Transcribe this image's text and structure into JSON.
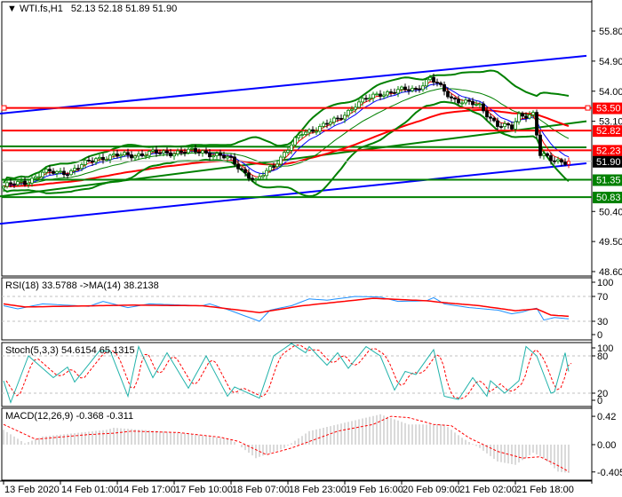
{
  "header": {
    "symbol": "WTI.fs,H1",
    "ohlc": "52.13 52.18 51.89 51.90"
  },
  "chart_data": {
    "type": "candlestick",
    "title": "WTI.fs,H1",
    "bars": 160,
    "price_range": [
      48.45,
      56.05
    ],
    "price_ticks": [
      "55.80",
      "54.90",
      "54.00",
      "53.10",
      "50.40",
      "49.50",
      "48.60"
    ],
    "time_labels": [
      {
        "bar": 0,
        "label": "13 Feb 2020"
      },
      {
        "bar": 16,
        "label": "14 Feb 01:00"
      },
      {
        "bar": 32,
        "label": "14 Feb 17:00"
      },
      {
        "bar": 48,
        "label": "17 Feb 10:00"
      },
      {
        "bar": 64,
        "label": "18 Feb 07:00"
      },
      {
        "bar": 80,
        "label": "18 Feb 23:00"
      },
      {
        "bar": 96,
        "label": "19 Feb 16:00"
      },
      {
        "bar": 112,
        "label": "20 Feb 09:00"
      },
      {
        "bar": 128,
        "label": "21 Feb 02:00"
      },
      {
        "bar": 144,
        "label": "21 Feb 18:00"
      }
    ],
    "close_keypoints": [
      [
        0,
        51.15
      ],
      [
        6,
        51.28
      ],
      [
        11,
        51.55
      ],
      [
        19,
        51.6
      ],
      [
        26,
        52.0
      ],
      [
        34,
        52.08
      ],
      [
        44,
        52.16
      ],
      [
        56,
        52.2
      ],
      [
        64,
        51.95
      ],
      [
        71,
        51.28
      ],
      [
        76,
        51.8
      ],
      [
        84,
        52.74
      ],
      [
        94,
        53.14
      ],
      [
        99,
        53.6
      ],
      [
        106,
        53.94
      ],
      [
        116,
        54.07
      ],
      [
        120,
        54.39
      ],
      [
        126,
        53.8
      ],
      [
        134,
        53.54
      ],
      [
        139,
        53.0
      ],
      [
        143,
        52.88
      ],
      [
        145,
        53.28
      ],
      [
        149,
        53.33
      ],
      [
        151,
        52.08
      ],
      [
        154,
        51.95
      ],
      [
        159,
        51.9
      ]
    ],
    "levels": [
      {
        "price": 53.5,
        "label": "53.50",
        "color": "#ff0000"
      },
      {
        "price": 52.82,
        "label": "52.82",
        "color": "#ff0000"
      },
      {
        "price": 52.23,
        "label": "52.23",
        "color": "#ff0000"
      },
      {
        "price": 51.9,
        "label": "51.90",
        "color": "#000000"
      },
      {
        "price": 51.35,
        "label": "51.35",
        "color": "#008000"
      },
      {
        "price": 50.83,
        "label": "50.83",
        "color": "#008000"
      }
    ],
    "channel": {
      "upper": [
        [
          -1,
          53.33
        ],
        [
          164,
          55.06
        ]
      ],
      "lower": [
        [
          -1,
          50.03
        ],
        [
          164,
          51.84
        ]
      ],
      "color": "#0000ff"
    },
    "green_trend": [
      [
        -1,
        50.85
      ],
      [
        164,
        53.1
      ]
    ],
    "green_flat": [
      [
        -1,
        52.35
      ],
      [
        164,
        52.32
      ]
    ],
    "rsi": {
      "label": "RSI(18) 33.5788  ->MA(14) 38.2138",
      "ticks": [
        "100",
        "70",
        "30",
        "0"
      ],
      "levels": [
        70,
        30
      ],
      "values": [
        [
          0,
          55
        ],
        [
          4,
          50
        ],
        [
          11,
          58
        ],
        [
          24,
          54
        ],
        [
          28,
          62
        ],
        [
          35,
          52
        ],
        [
          41,
          58
        ],
        [
          56,
          55
        ],
        [
          58,
          58
        ],
        [
          64,
          47
        ],
        [
          72,
          30
        ],
        [
          75,
          48
        ],
        [
          81,
          55
        ],
        [
          86,
          66
        ],
        [
          91,
          64
        ],
        [
          99,
          70
        ],
        [
          106,
          69
        ],
        [
          111,
          62
        ],
        [
          119,
          63
        ],
        [
          121,
          68
        ],
        [
          124,
          58
        ],
        [
          131,
          52
        ],
        [
          139,
          48
        ],
        [
          143,
          42
        ],
        [
          146,
          45
        ],
        [
          149,
          50
        ],
        [
          150,
          51
        ],
        [
          152,
          32
        ],
        [
          155,
          36
        ],
        [
          159,
          34
        ]
      ],
      "ma": [
        [
          0,
          58
        ],
        [
          6,
          53
        ],
        [
          36,
          56
        ],
        [
          56,
          55
        ],
        [
          72,
          44
        ],
        [
          84,
          55
        ],
        [
          104,
          67
        ],
        [
          119,
          63
        ],
        [
          124,
          60
        ],
        [
          134,
          55
        ],
        [
          144,
          47
        ],
        [
          150,
          50
        ],
        [
          154,
          40
        ],
        [
          159,
          38
        ]
      ]
    },
    "stoch": {
      "label": "Stoch(5,3,3) 54.6154 65.1315",
      "ticks": [
        "100",
        "80",
        "20",
        "0"
      ],
      "levels": [
        80,
        20
      ],
      "k": [
        [
          0,
          40
        ],
        [
          2,
          5
        ],
        [
          7,
          80
        ],
        [
          14,
          45
        ],
        [
          18,
          62
        ],
        [
          20,
          38
        ],
        [
          27,
          88
        ],
        [
          30,
          88
        ],
        [
          35,
          15
        ],
        [
          38,
          95
        ],
        [
          42,
          45
        ],
        [
          46,
          85
        ],
        [
          52,
          28
        ],
        [
          57,
          80
        ],
        [
          63,
          15
        ],
        [
          65,
          30
        ],
        [
          72,
          12
        ],
        [
          76,
          80
        ],
        [
          81,
          100
        ],
        [
          85,
          85
        ],
        [
          86,
          95
        ],
        [
          91,
          65
        ],
        [
          94,
          85
        ],
        [
          97,
          60
        ],
        [
          102,
          95
        ],
        [
          106,
          80
        ],
        [
          110,
          25
        ],
        [
          113,
          55
        ],
        [
          116,
          50
        ],
        [
          121,
          90
        ],
        [
          124,
          15
        ],
        [
          128,
          10
        ],
        [
          132,
          45
        ],
        [
          136,
          15
        ],
        [
          137,
          40
        ],
        [
          141,
          20
        ],
        [
          145,
          40
        ],
        [
          147,
          95
        ],
        [
          150,
          80
        ],
        [
          154,
          20
        ],
        [
          155,
          22
        ],
        [
          158,
          85
        ],
        [
          159,
          55
        ]
      ]
    },
    "macd": {
      "label": "MACD(12,26,9) -0.368 -0.311",
      "ticks": [
        "0.42",
        "0.00",
        "-0.405"
      ],
      "range": [
        -0.46,
        0.52
      ],
      "hist": [
        [
          0,
          0.22
        ],
        [
          6,
          0.02
        ],
        [
          11,
          0.12
        ],
        [
          29,
          0.22
        ],
        [
          31,
          0.25
        ],
        [
          49,
          0.18
        ],
        [
          64,
          0.08
        ],
        [
          71,
          -0.2
        ],
        [
          79,
          -0.05
        ],
        [
          86,
          0.2
        ],
        [
          106,
          0.45
        ],
        [
          114,
          0.3
        ],
        [
          124,
          0.3
        ],
        [
          129,
          0.1
        ],
        [
          134,
          -0.05
        ],
        [
          139,
          -0.25
        ],
        [
          144,
          -0.3
        ],
        [
          149,
          -0.12
        ],
        [
          152,
          -0.2
        ],
        [
          156,
          -0.4
        ],
        [
          159,
          -0.42
        ]
      ],
      "signal": [
        [
          0,
          0.3
        ],
        [
          9,
          0.08
        ],
        [
          24,
          0.15
        ],
        [
          31,
          0.17
        ],
        [
          36,
          0.2
        ],
        [
          49,
          0.18
        ],
        [
          61,
          0.11
        ],
        [
          66,
          0.05
        ],
        [
          74,
          -0.15
        ],
        [
          81,
          -0.05
        ],
        [
          94,
          0.2
        ],
        [
          104,
          0.3
        ],
        [
          109,
          0.42
        ],
        [
          114,
          0.4
        ],
        [
          121,
          0.3
        ],
        [
          126,
          0.28
        ],
        [
          131,
          0.1
        ],
        [
          139,
          -0.1
        ],
        [
          146,
          -0.2
        ],
        [
          151,
          -0.18
        ],
        [
          156,
          -0.31
        ],
        [
          159,
          -0.4
        ]
      ]
    }
  }
}
